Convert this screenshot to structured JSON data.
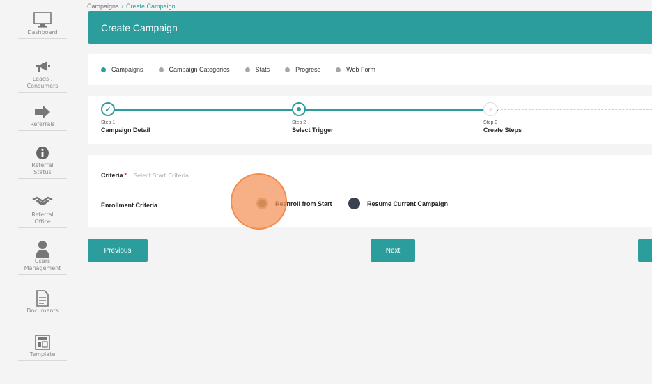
{
  "breadcrumb": {
    "parent": "Campaigns",
    "separator": "/",
    "current": "Create Campaign"
  },
  "header": {
    "title": "Create Campaign"
  },
  "sidebar": {
    "items": [
      {
        "label": "Dashboard",
        "icon": "monitor-icon"
      },
      {
        "label": "Leads ,\nConsumers",
        "icon": "megaphone-icon"
      },
      {
        "label": "Referrals",
        "icon": "arrow-right-icon"
      },
      {
        "label": "Referral\nStatus",
        "icon": "info-icon"
      },
      {
        "label": "Referral\nOffice",
        "icon": "handshake-icon"
      },
      {
        "label": "Users\nManagement",
        "icon": "user-icon"
      },
      {
        "label": "Documents",
        "icon": "document-icon"
      },
      {
        "label": "Template",
        "icon": "template-icon"
      }
    ]
  },
  "tabs": [
    {
      "label": "Campaigns",
      "active": true
    },
    {
      "label": "Campaign Categories",
      "active": false
    },
    {
      "label": "Stats",
      "active": false
    },
    {
      "label": "Progress",
      "active": false
    },
    {
      "label": "Web Form",
      "active": false
    }
  ],
  "steps": [
    {
      "num": "Step 1",
      "name": "Campaign Detail",
      "state": "done"
    },
    {
      "num": "Step 2",
      "name": "Select Trigger",
      "state": "current"
    },
    {
      "num": "Step 3",
      "name": "Create Steps",
      "state": "pending"
    }
  ],
  "form": {
    "criteria_label": "Criteria",
    "required_mark": "*",
    "criteria_placeholder": "Select Start Criteria",
    "enrollment_label": "Enrollment Criteria",
    "options": [
      {
        "label": "Reenroll from Start",
        "selected": true
      },
      {
        "label": "Resume Current Campaign",
        "selected": false
      }
    ]
  },
  "buttons": {
    "previous": "Previous",
    "next": "Next"
  },
  "colors": {
    "accent": "#2b9d9d",
    "click_marker": "#f49058",
    "required": "#d0302f"
  }
}
